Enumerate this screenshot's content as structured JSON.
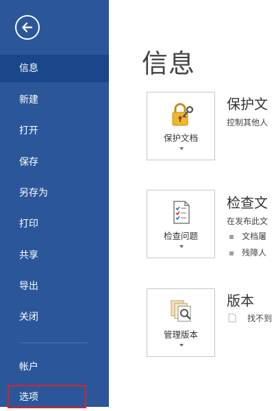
{
  "sidebar": {
    "back_label": "返回",
    "items": [
      {
        "label": "信息"
      },
      {
        "label": "新建"
      },
      {
        "label": "打开"
      },
      {
        "label": "保存"
      },
      {
        "label": "另存为"
      },
      {
        "label": "打印"
      },
      {
        "label": "共享"
      },
      {
        "label": "导出"
      },
      {
        "label": "关闭"
      },
      {
        "label": "帐户"
      },
      {
        "label": "选项"
      }
    ],
    "active_item": "信息",
    "highlighted_item": "选项"
  },
  "main": {
    "title": "信息",
    "sections": [
      {
        "button_label": "保护文档",
        "button_icon": "lock-key-icon",
        "title": "保护文",
        "description": "控制其他人"
      },
      {
        "button_label": "检查问题",
        "button_icon": "inspect-document-icon",
        "title": "检查文",
        "description": "在发布此文",
        "bullets": [
          "文档屠",
          "残障人"
        ]
      },
      {
        "button_label": "管理版本",
        "button_icon": "manage-versions-icon",
        "title": "版本",
        "description": "找不到"
      }
    ]
  },
  "colors": {
    "sidebar_bg": "#2b579a",
    "sidebar_active_bg": "#19478a",
    "highlight_border": "#d8222a"
  }
}
